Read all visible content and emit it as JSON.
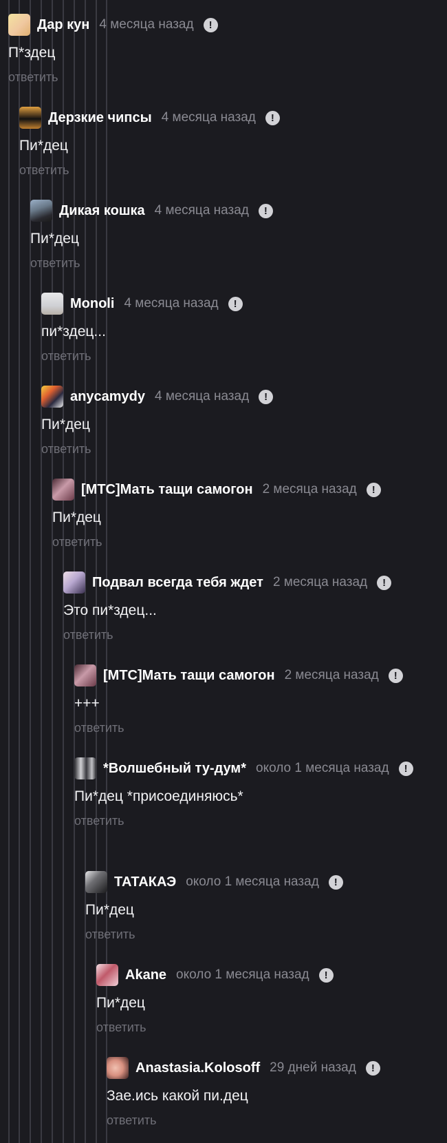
{
  "comments": [
    {
      "author": "Дар кун",
      "time": "4 месяца назад",
      "text": "П*здец",
      "reply": "ответить"
    },
    {
      "author": "Дерзкие чипсы",
      "time": "4 месяца назад",
      "text": "Пи*дец",
      "reply": "ответить"
    },
    {
      "author": "Дикая кошка",
      "time": "4 месяца назад",
      "text": "Пи*дец",
      "reply": "ответить"
    },
    {
      "author": "Monoli",
      "time": "4 месяца назад",
      "text": "пи*здец...",
      "reply": "ответить"
    },
    {
      "author": "anycamydy",
      "time": "4 месяца назад",
      "text": "Пи*дец",
      "reply": "ответить"
    },
    {
      "author": "[МТС]Мать тащи самогон",
      "time": "2 месяца назад",
      "text": "Пи*дец",
      "reply": "ответить"
    },
    {
      "author": "Подвал всегда тебя ждет",
      "time": "2 месяца назад",
      "text": "Это пи*здец...",
      "reply": "ответить"
    },
    {
      "author": "[МТС]Мать тащи самогон",
      "time": "2 месяца назад",
      "text": "+++",
      "reply": "ответить"
    },
    {
      "author": "*Волшебный ту-дум*",
      "time": "около 1 месяца назад",
      "text": "Пи*дец *присоединяюсь*",
      "reply": "ответить"
    },
    {
      "author": "ТАТАКАЭ",
      "time": "около 1 месяца назад",
      "text": "Пи*дец",
      "reply": "ответить"
    },
    {
      "author": "Akane",
      "time": "около 1 месяца назад",
      "text": "Пи*дец",
      "reply": "ответить"
    },
    {
      "author": "Anastasia.Kolosoff",
      "time": "29 дней назад",
      "text": "Зае.ись какой пи.дец",
      "reply": "ответить"
    }
  ],
  "report_icon": "exclamation-circle-icon",
  "colors": {
    "background": "#1b1b20",
    "thread_line": "#3a3a42",
    "author": "#ffffff",
    "time": "#8a8a92",
    "reply": "#6f6f77"
  }
}
